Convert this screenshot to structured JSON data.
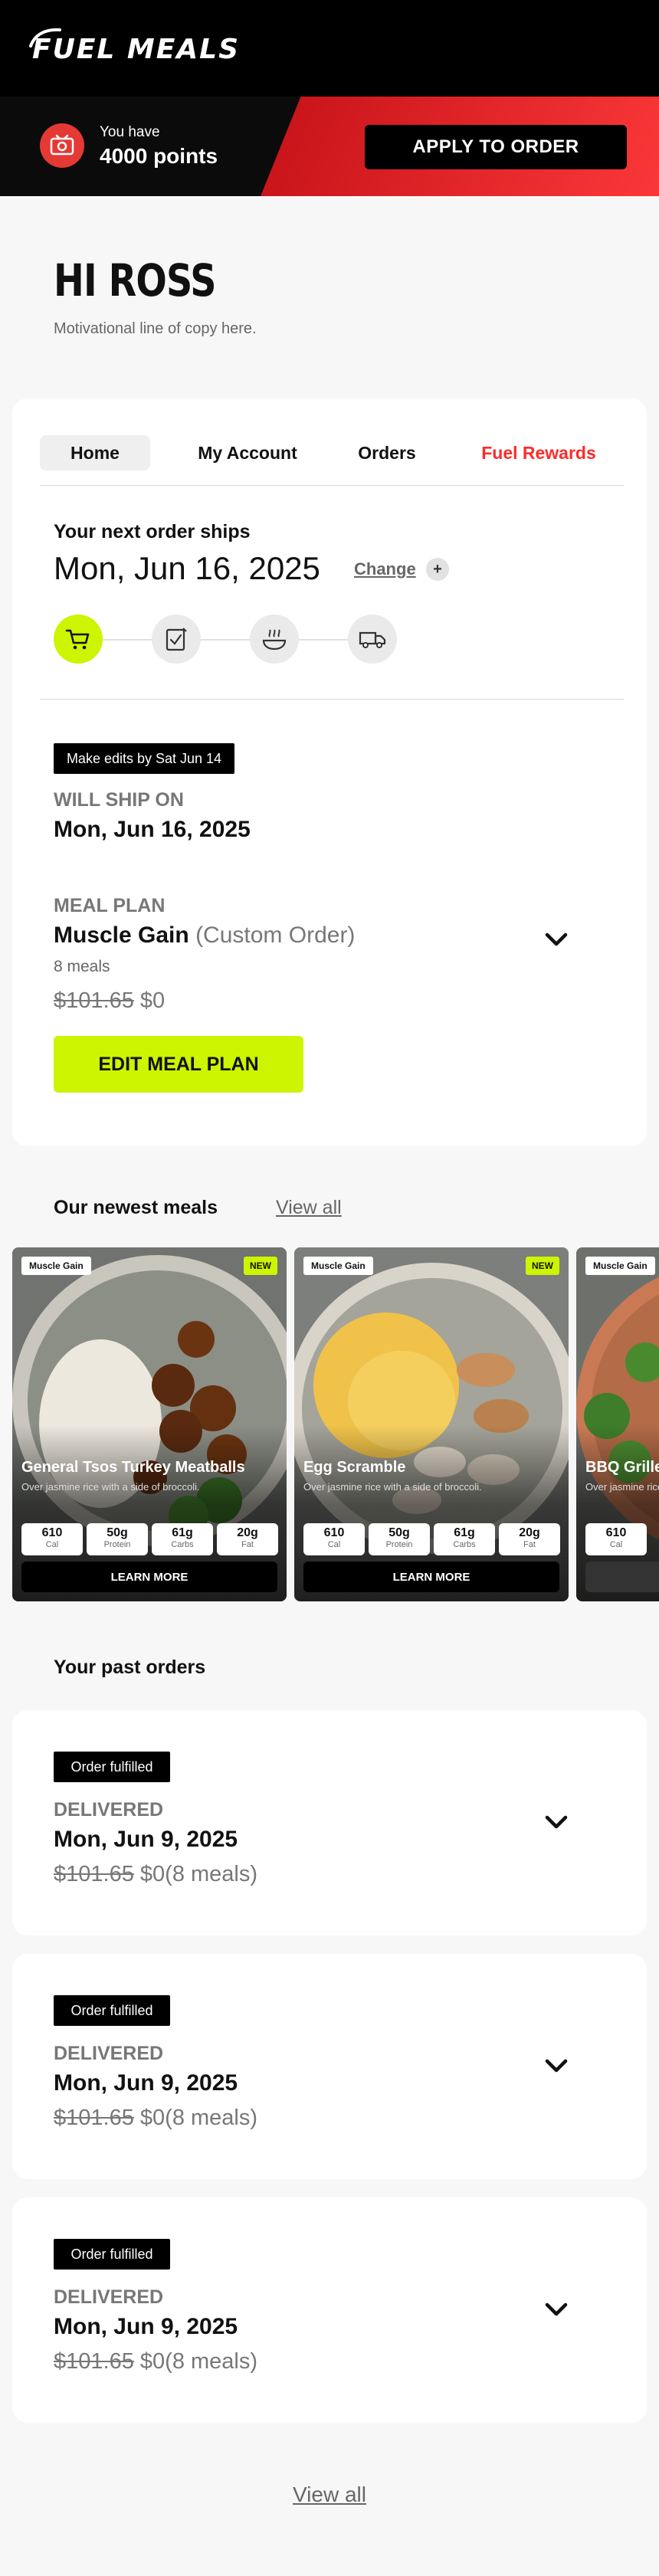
{
  "header": {
    "logo_text": "FUEL MEALS",
    "points_prefix": "You have",
    "points_value": "4000 points",
    "apply_label": "APPLY TO ORDER"
  },
  "greeting": {
    "title": "HI ROSS",
    "subtitle": "Motivational line of copy here."
  },
  "tabs": [
    {
      "label": "Home",
      "active": true
    },
    {
      "label": "My Account"
    },
    {
      "label": "Orders"
    },
    {
      "label": "Fuel Rewards"
    }
  ],
  "next_order": {
    "label": "Your next order ships",
    "date": "Mon, Jun 16, 2025",
    "change_label": "Change",
    "plus_label": "+",
    "steps": [
      {
        "icon": "cart-icon",
        "done": true
      },
      {
        "icon": "checklist-icon",
        "done": false
      },
      {
        "icon": "cooking-icon",
        "done": false
      },
      {
        "icon": "delivery-truck-icon",
        "done": false
      }
    ],
    "edit_tag": "Make edits by Sat Jun 14",
    "ship_caption": "WILL SHIP ON",
    "ship_date": "Mon, Jun 16, 2025",
    "plan_caption": "MEAL PLAN",
    "plan_name": "Muscle Gain",
    "plan_type": "(Custom Order)",
    "plan_meals": "8 meals",
    "price_old": "$101.65",
    "price_new": "$0",
    "edit_label": "EDIT MEAL PLAN"
  },
  "newest_meals": {
    "title": "Our newest meals",
    "view_all": "View all",
    "items": [
      {
        "badge": "Muscle Gain",
        "new_badge": "NEW",
        "name": "General Tsos Turkey Meatballs",
        "desc": "Over jasmine rice with a side of broccoli.",
        "nutrition": [
          {
            "value": "610",
            "label": "Cal"
          },
          {
            "value": "50g",
            "label": "Protein"
          },
          {
            "value": "61g",
            "label": "Carbs"
          },
          {
            "value": "20g",
            "label": "Fat"
          }
        ],
        "cta": "LEARN MORE"
      },
      {
        "badge": "Muscle Gain",
        "new_badge": "NEW",
        "name": "Egg Scramble",
        "desc": "Over jasmine rice with a side of broccoli.",
        "nutrition": [
          {
            "value": "610",
            "label": "Cal"
          },
          {
            "value": "50g",
            "label": "Protein"
          },
          {
            "value": "61g",
            "label": "Carbs"
          },
          {
            "value": "20g",
            "label": "Fat"
          }
        ],
        "cta": "LEARN MORE"
      },
      {
        "badge": "Muscle Gain",
        "name": "BBQ Grilled",
        "desc": "Over jasmine rice",
        "nutrition": [
          {
            "value": "610",
            "label": "Cal"
          }
        ]
      }
    ]
  },
  "past_orders": {
    "title": "Your past orders",
    "items": [
      {
        "tag": "Order fulfilled",
        "caption": "DELIVERED",
        "date": "Mon, Jun 9, 2025",
        "price_old": "$101.65",
        "price_new": "$0",
        "meals": "(8 meals)"
      },
      {
        "tag": "Order fulfilled",
        "caption": "DELIVERED",
        "date": "Mon, Jun 9, 2025",
        "price_old": "$101.65",
        "price_new": "$0",
        "meals": "(8 meals)"
      },
      {
        "tag": "Order fulfilled",
        "caption": "DELIVERED",
        "date": "Mon, Jun 9, 2025",
        "price_old": "$101.65",
        "price_new": "$0",
        "meals": "(8 meals)"
      }
    ],
    "view_all": "View all"
  },
  "colors": {
    "accent_lime": "#cdf400",
    "brand_red": "#ff2a2a",
    "black": "#000000"
  }
}
